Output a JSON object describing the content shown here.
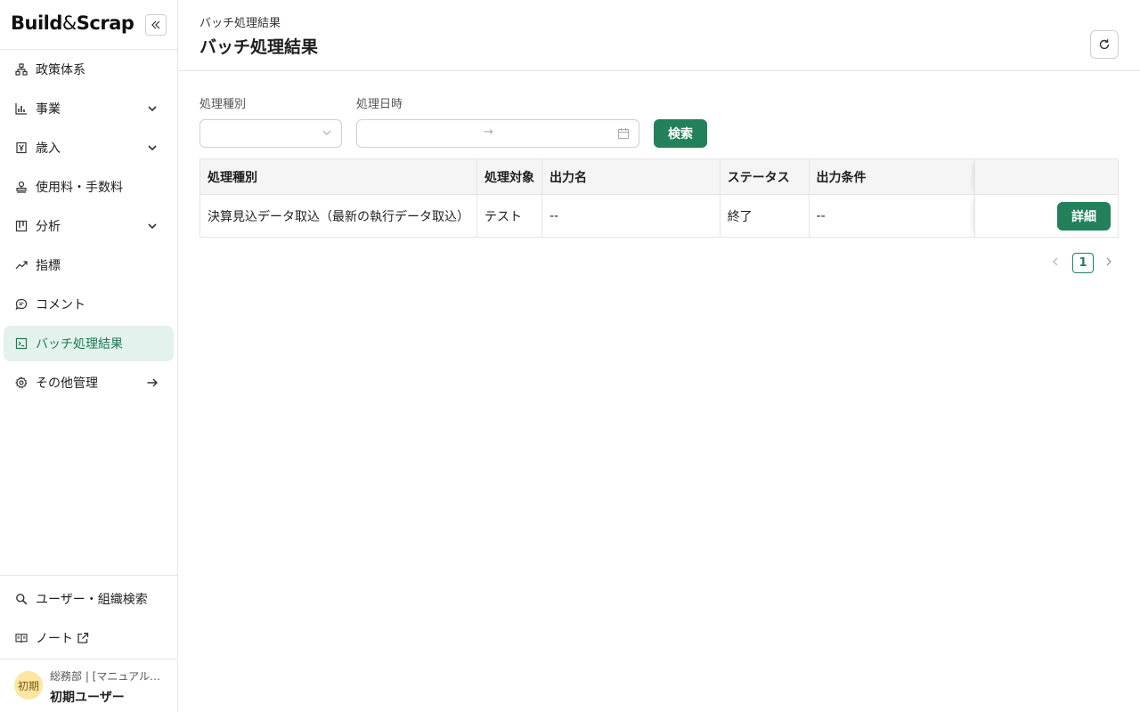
{
  "brand": {
    "logo_left": "Build",
    "logo_amp": "&",
    "logo_right": "Scrap"
  },
  "sidebar": {
    "items": [
      {
        "label": "政策体系",
        "icon": "hierarchy-icon"
      },
      {
        "label": "事業",
        "icon": "bar-chart-icon"
      },
      {
        "label": "歳入",
        "icon": "yen-box-icon"
      },
      {
        "label": "使用料・手数料",
        "icon": "stamp-icon"
      },
      {
        "label": "分析",
        "icon": "board-icon"
      },
      {
        "label": "指標",
        "icon": "trend-line-icon"
      },
      {
        "label": "コメント",
        "icon": "chat-icon"
      },
      {
        "label": "バッチ処理結果",
        "icon": "terminal-icon"
      },
      {
        "label": "その他管理",
        "icon": "gear-icon"
      }
    ],
    "bottom": [
      {
        "label": "ユーザー・組織検索",
        "icon": "search-icon"
      },
      {
        "label": "ノート",
        "icon": "book-icon"
      }
    ],
    "user": {
      "avatar": "初期",
      "dept": "総務部 | [マニュアル…",
      "name": "初期ユーザー"
    }
  },
  "header": {
    "breadcrumb": "バッチ処理結果",
    "title": "バッチ処理結果"
  },
  "filters": {
    "type_label": "処理種別",
    "date_label": "処理日時",
    "date_sep": "→",
    "search_label": "検索"
  },
  "table": {
    "columns": [
      "処理種別",
      "処理対象",
      "出力名",
      "ステータス",
      "出力条件",
      ""
    ],
    "rows": [
      {
        "type": "決算見込データ取込（最新の執行データ取込）",
        "target": "テスト",
        "output": "--",
        "status": "終了",
        "condition": "--",
        "action": "詳細"
      }
    ]
  },
  "pagination": {
    "current": "1"
  },
  "colors": {
    "accent": "#22805b",
    "active_bg": "#e3f2ec"
  }
}
